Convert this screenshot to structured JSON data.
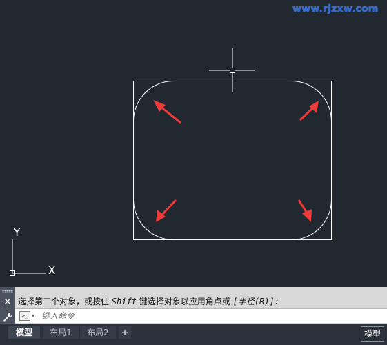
{
  "watermark": "www.rjzxw.com",
  "ucs": {
    "y_label": "Y",
    "x_label": "X"
  },
  "command": {
    "history_prefix": "选择第二个对象，或按住 ",
    "history_key": "Shift",
    "history_middle": " 键选择对象以应用角点或 ",
    "history_option": "[半径(R)]:",
    "prompt_icon": ">_",
    "input_placeholder": "键入命令"
  },
  "tabs": [
    "模型",
    "布局1",
    "布局2",
    "+"
  ],
  "status": {
    "space": "模型"
  },
  "colors": {
    "background": "#212830",
    "geometry": "#ffffff",
    "arrows": "#f03a3a",
    "watermark": "#2f6bd8"
  },
  "icons": [
    "close-icon",
    "wrench-icon",
    "command-prompt-icon",
    "crosshair-cursor",
    "ucs-icon"
  ]
}
